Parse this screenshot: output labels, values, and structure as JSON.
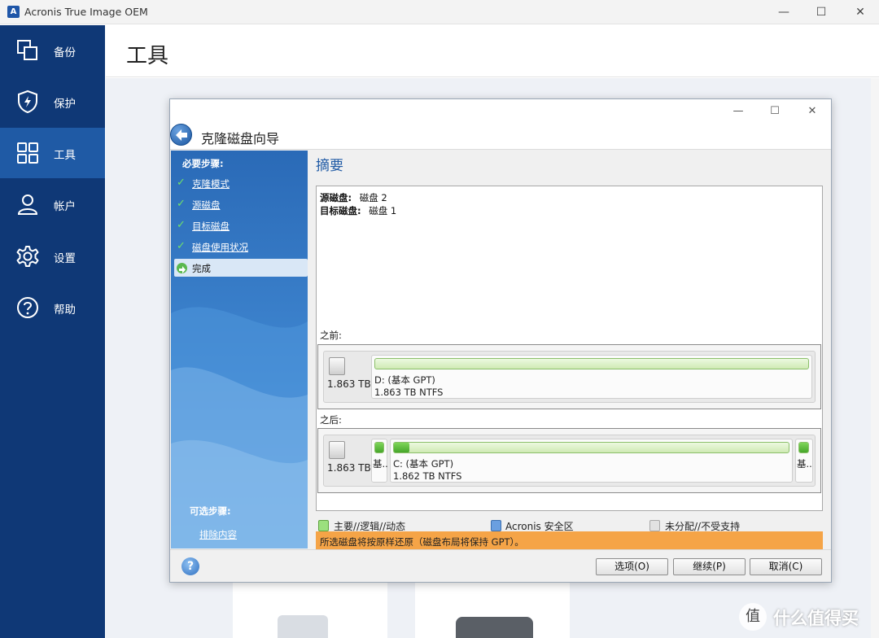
{
  "window": {
    "title": "Acronis True Image OEM",
    "controls": {
      "minimize": "—",
      "maximize": "☐",
      "close": "✕"
    }
  },
  "sidebar": {
    "items": [
      {
        "label": "备份",
        "icon": "copy-icon",
        "active": false
      },
      {
        "label": "保护",
        "icon": "shield-icon",
        "active": false
      },
      {
        "label": "工具",
        "icon": "grid-icon",
        "active": true
      },
      {
        "label": "帐户",
        "icon": "user-icon",
        "active": false
      },
      {
        "label": "设置",
        "icon": "gear-icon",
        "active": false
      },
      {
        "label": "帮助",
        "icon": "help-icon",
        "active": false
      }
    ]
  },
  "page": {
    "title": "工具"
  },
  "dialog": {
    "title": "克隆磁盘向导",
    "required_steps_label": "必要步骤:",
    "steps": [
      {
        "label": "克隆模式",
        "done": true
      },
      {
        "label": "源磁盘",
        "done": true
      },
      {
        "label": "目标磁盘",
        "done": true
      },
      {
        "label": "磁盘使用状况",
        "done": true
      },
      {
        "label": "完成",
        "current": true
      }
    ],
    "optional_steps_label": "可选步骤:",
    "optional_link": "排除内容",
    "summary": {
      "heading": "摘要",
      "source_key": "源磁盘:",
      "source_value": "磁盘 2",
      "target_key": "目标磁盘:",
      "target_value": "磁盘 1",
      "before_label": "之前:",
      "after_label": "之后:",
      "before_disk": {
        "size": "1.863 TB",
        "partition_name": "D: (基本 GPT)",
        "partition_info": "1.863 TB  NTFS",
        "used_fraction": 0.0
      },
      "after_disk": {
        "size": "1.863 TB",
        "small_part_left_label": "基...",
        "partition_name": "C: (基本 GPT)",
        "partition_info": "1.862 TB  NTFS",
        "used_fraction": 0.04,
        "small_part_right_label": "基..."
      }
    },
    "legend": {
      "primary": "主要//逻辑//动态",
      "acronis": "Acronis 安全区",
      "unallocated": "未分配//不受支持"
    },
    "notice": "所选磁盘将按原样还原（磁盘布局将保持 GPT）。",
    "buttons": {
      "options": "选项(O)",
      "next": "继续(P)",
      "cancel": "取消(C)"
    },
    "colors": {
      "accent": "#1f5aa5",
      "notice_bg": "#f5a447",
      "partition_green": "#46a62a"
    }
  },
  "watermark": {
    "badge": "值",
    "text": "什么值得买"
  }
}
